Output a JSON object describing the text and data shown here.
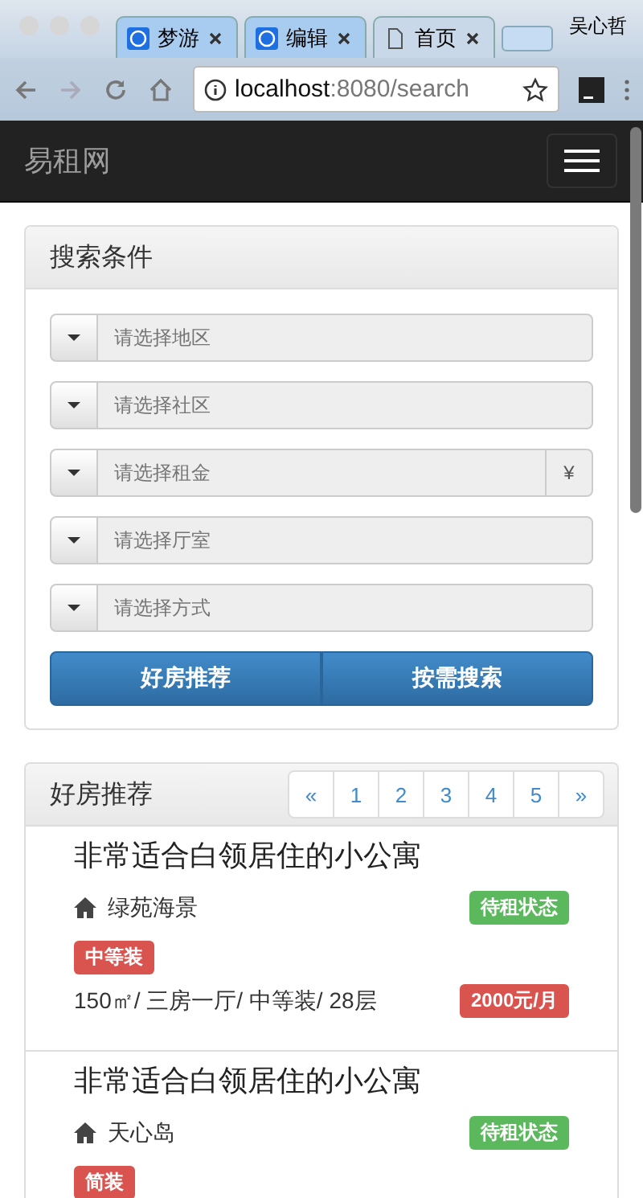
{
  "browser": {
    "tabs": [
      {
        "label": "梦游",
        "kind": "app",
        "selected": false
      },
      {
        "label": "编辑",
        "kind": "app",
        "selected": false
      },
      {
        "label": "首页",
        "kind": "page",
        "selected": true
      }
    ],
    "user": "吴心哲",
    "url_host": "localhost",
    "url_rest": ":8080/search"
  },
  "navbar": {
    "brand": "易租网"
  },
  "search_panel": {
    "title": "搜索条件",
    "selects": [
      {
        "placeholder": "请选择地区"
      },
      {
        "placeholder": "请选择社区"
      },
      {
        "placeholder": "请选择租金",
        "addon": "¥"
      },
      {
        "placeholder": "请选择厅室"
      },
      {
        "placeholder": "请选择方式"
      }
    ],
    "buttons": [
      "好房推荐",
      "按需搜索"
    ]
  },
  "results_panel": {
    "title": "好房推荐",
    "pagination": [
      "«",
      "1",
      "2",
      "3",
      "4",
      "5",
      "»"
    ],
    "listings": [
      {
        "title": "非常适合白领居住的小公寓",
        "community": "绿苑海景",
        "status": "待租状态",
        "decoration": "中等装",
        "details": "150㎡/ 三房一厅/ 中等装/ 28层",
        "price": "2000元/月"
      },
      {
        "title": "非常适合白领居住的小公寓",
        "community": "天心岛",
        "status": "待租状态",
        "decoration": "简装"
      }
    ]
  }
}
